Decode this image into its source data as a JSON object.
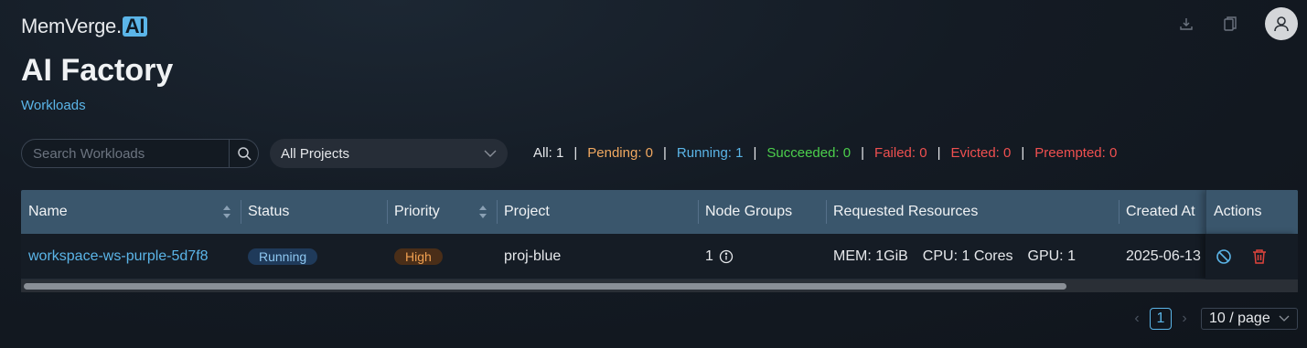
{
  "header": {
    "logo_text": "MemVerge.",
    "logo_badge": "AI",
    "title": "AI Factory",
    "breadcrumb": "Workloads"
  },
  "filters": {
    "search_placeholder": "Search Workloads",
    "project_select": "All Projects"
  },
  "counts": [
    {
      "label": "All: 1",
      "color": "#e6e8eb"
    },
    {
      "label": "Pending: 0",
      "color": "#f0a860"
    },
    {
      "label": "Running: 1",
      "color": "#5bb5e8"
    },
    {
      "label": "Succeeded: 0",
      "color": "#4ccf4c"
    },
    {
      "label": "Failed: 0",
      "color": "#f05050"
    },
    {
      "label": "Evicted: 0",
      "color": "#f05050"
    },
    {
      "label": "Preempted: 0",
      "color": "#f05050"
    }
  ],
  "table": {
    "columns": [
      "Name",
      "Status",
      "Priority",
      "Project",
      "Node Groups",
      "Requested Resources",
      "Created At",
      "Actions"
    ],
    "rows": [
      {
        "name": "workspace-ws-purple-5d7f8",
        "status": "Running",
        "priority": "High",
        "project": "proj-blue",
        "node_groups": "1",
        "mem": "MEM: 1GiB",
        "cpu": "CPU: 1 Cores",
        "gpu": "GPU: 1",
        "created_at": "2025-06-13"
      }
    ]
  },
  "pagination": {
    "current_page": "1",
    "page_size": "10 / page"
  },
  "colors": {
    "accent": "#5bb5e8",
    "header_bg": "#3a566c",
    "danger": "#e0443c"
  }
}
